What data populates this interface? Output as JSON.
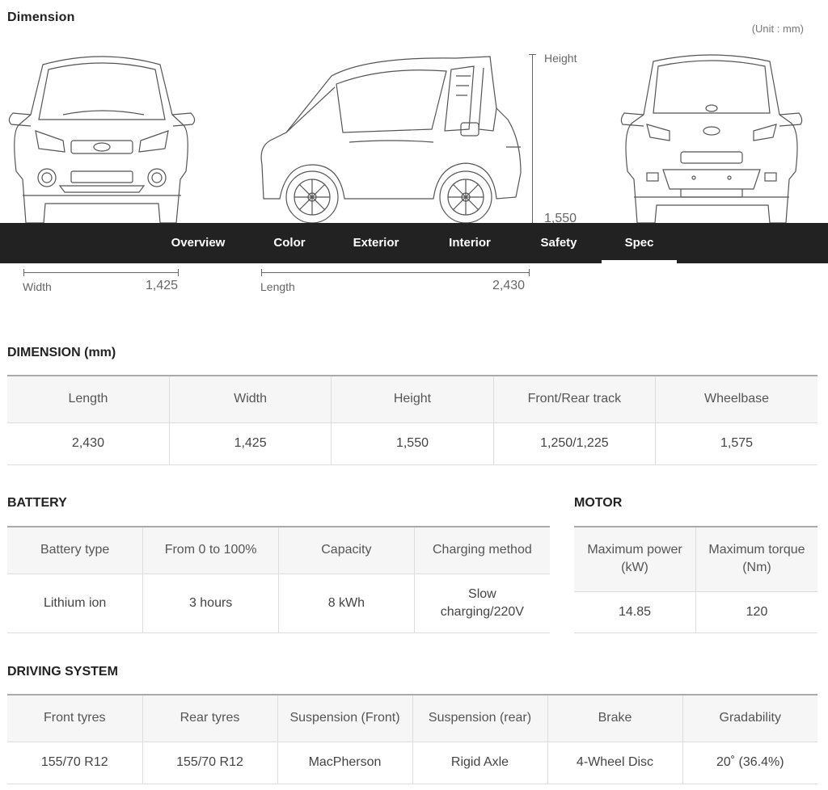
{
  "header": {
    "title": "Dimension",
    "unit_note": "(Unit : mm)"
  },
  "drawings": {
    "height_label": "Height",
    "height_value": "1,550",
    "width_label": "Width",
    "width_value": "1,425",
    "length_label": "Length",
    "length_value": "2,430"
  },
  "nav": {
    "items": [
      "Overview",
      "Color",
      "Exterior",
      "Interior",
      "Safety",
      "Spec"
    ],
    "active": "Spec"
  },
  "dimension": {
    "title": "DIMENSION (mm)",
    "headers": [
      "Length",
      "Width",
      "Height",
      "Front/Rear track",
      "Wheelbase"
    ],
    "values": [
      "2,430",
      "1,425",
      "1,550",
      "1,250/1,225",
      "1,575"
    ]
  },
  "battery": {
    "title": "BATTERY",
    "headers": [
      "Battery type",
      "From 0 to 100%",
      "Capacity",
      "Charging method"
    ],
    "values": [
      "Lithium ion",
      "3 hours",
      "8 kWh",
      "Slow charging/220V"
    ]
  },
  "motor": {
    "title": "MOTOR",
    "headers": [
      "Maximum power (kW)",
      "Maximum torque (Nm)"
    ],
    "values": [
      "14.85",
      "120"
    ]
  },
  "driving": {
    "title": "DRIVING SYSTEM",
    "headers": [
      "Front tyres",
      "Rear tyres",
      "Suspension (Front)",
      "Suspension (rear)",
      "Brake",
      "Gradability"
    ],
    "values": [
      "155/70 R12",
      "155/70 R12",
      "MacPherson",
      "Rigid Axle",
      "4-Wheel Disc",
      "20˚ (36.4%)"
    ]
  },
  "colors": {
    "navbar": "#222222",
    "line_art": "#555555"
  }
}
